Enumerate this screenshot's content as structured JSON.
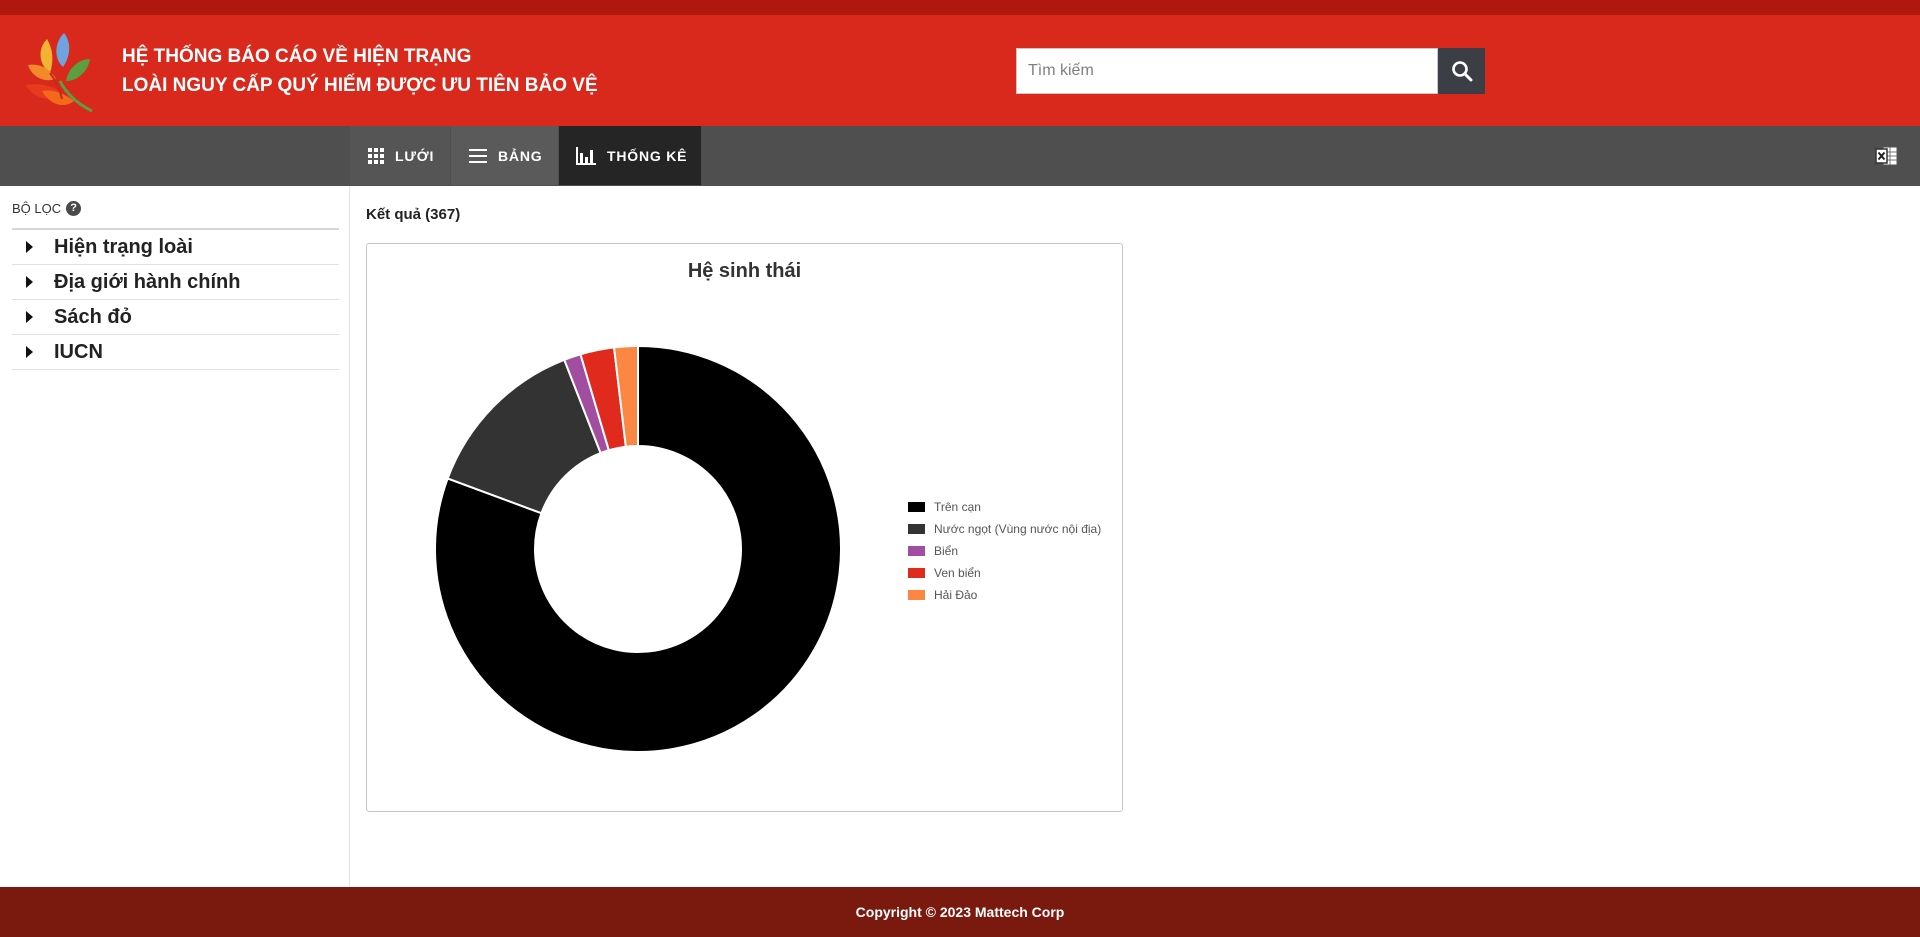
{
  "header": {
    "title_line1": "HỆ THỐNG BÁO CÁO VỀ HIỆN TRẠNG",
    "title_line2": "LOÀI NGUY CẤP QUÝ HIẾM ĐƯỢC ƯU TIÊN BẢO VỆ",
    "logo_icon": "flower-logo-icon",
    "search": {
      "placeholder": "Tìm kiếm",
      "value": "",
      "icon": "search-icon"
    }
  },
  "toolbar": {
    "tabs": [
      {
        "label": "LƯỚI",
        "icon": "grid-icon",
        "active": false
      },
      {
        "label": "BẢNG",
        "icon": "list-icon",
        "active": false
      },
      {
        "label": "THỐNG KÊ",
        "icon": "bar-chart-icon",
        "active": true
      }
    ],
    "export_icon": "excel-export-icon"
  },
  "sidebar": {
    "heading": "BỘ LỌC",
    "help_icon": "question-icon",
    "filters": [
      {
        "label": "Hiện trạng loài"
      },
      {
        "label": "Địa giới hành chính"
      },
      {
        "label": "Sách đỏ"
      },
      {
        "label": "IUCN"
      }
    ]
  },
  "main": {
    "result_label": "Kết quả (367)"
  },
  "chart_data": {
    "type": "pie",
    "variant": "donut",
    "title": "Hệ sinh thái",
    "categories": [
      "Trên cạn",
      "Nước ngọt (Vùng nước nội địa)",
      "Biển",
      "Ven biển",
      "Hải Đảo"
    ],
    "values": [
      300,
      50,
      5,
      10,
      7
    ],
    "colors": [
      "#000000",
      "#333333",
      "#a24ea0",
      "#e02a1e",
      "#fb8743"
    ],
    "legend_position": "right"
  },
  "footer": {
    "copyright": "Copyright © 2023 Mattech Corp"
  },
  "colors": {
    "header_red": "#d9291c",
    "top_strip": "#b0180f",
    "toolbar_gray": "#4f4f4f",
    "active_tab": "#252525",
    "footer_dark_red": "#7a1a0f"
  }
}
